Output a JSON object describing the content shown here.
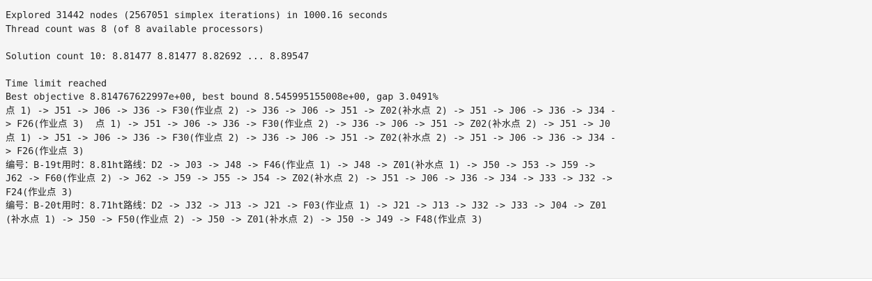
{
  "console": {
    "lines": [
      "Explored 31442 nodes (2567051 simplex iterations) in 1000.16 seconds",
      "Thread count was 8 (of 8 available processors)",
      "",
      "Solution count 10: 8.81477 8.81477 8.82692 ... 8.89547",
      "",
      "Time limit reached",
      "Best objective 8.814767622997e+00, best bound 8.545995155008e+00, gap 3.0491%",
      "点 1) -> J51 -> J06 -> J36 -> F30(作业点 2) -> J36 -> J06 -> J51 -> Z02(补水点 2) -> J51 -> J06 -> J36 -> J34 -",
      "> F26(作业点 3)  点 1) -> J51 -> J06 -> J36 -> F30(作业点 2) -> J36 -> J06 -> J51 -> Z02(补水点 2) -> J51 -> J0",
      "点 1) -> J51 -> J06 -> J36 -> F30(作业点 2) -> J36 -> J06 -> J51 -> Z02(补水点 2) -> J51 -> J06 -> J36 -> J34 -",
      "> F26(作业点 3)",
      "编号：B-19t用时：8.81ht路线：D2 -> J03 -> J48 -> F46(作业点 1) -> J48 -> Z01(补水点 1) -> J50 -> J53 -> J59 ->",
      "J62 -> F60(作业点 2) -> J62 -> J59 -> J55 -> J54 -> Z02(补水点 2) -> J51 -> J06 -> J36 -> J34 -> J33 -> J32 ->",
      "F24(作业点 3)",
      "编号：B-20t用时：8.71ht路线：D2 -> J32 -> J13 -> J21 -> F03(作业点 1) -> J21 -> J13 -> J32 -> J33 -> J04 -> Z01",
      "(补水点 1) -> J50 -> F50(作业点 2) -> J50 -> Z01(补水点 2) -> J50 -> J49 -> F48(作业点 3)"
    ]
  }
}
